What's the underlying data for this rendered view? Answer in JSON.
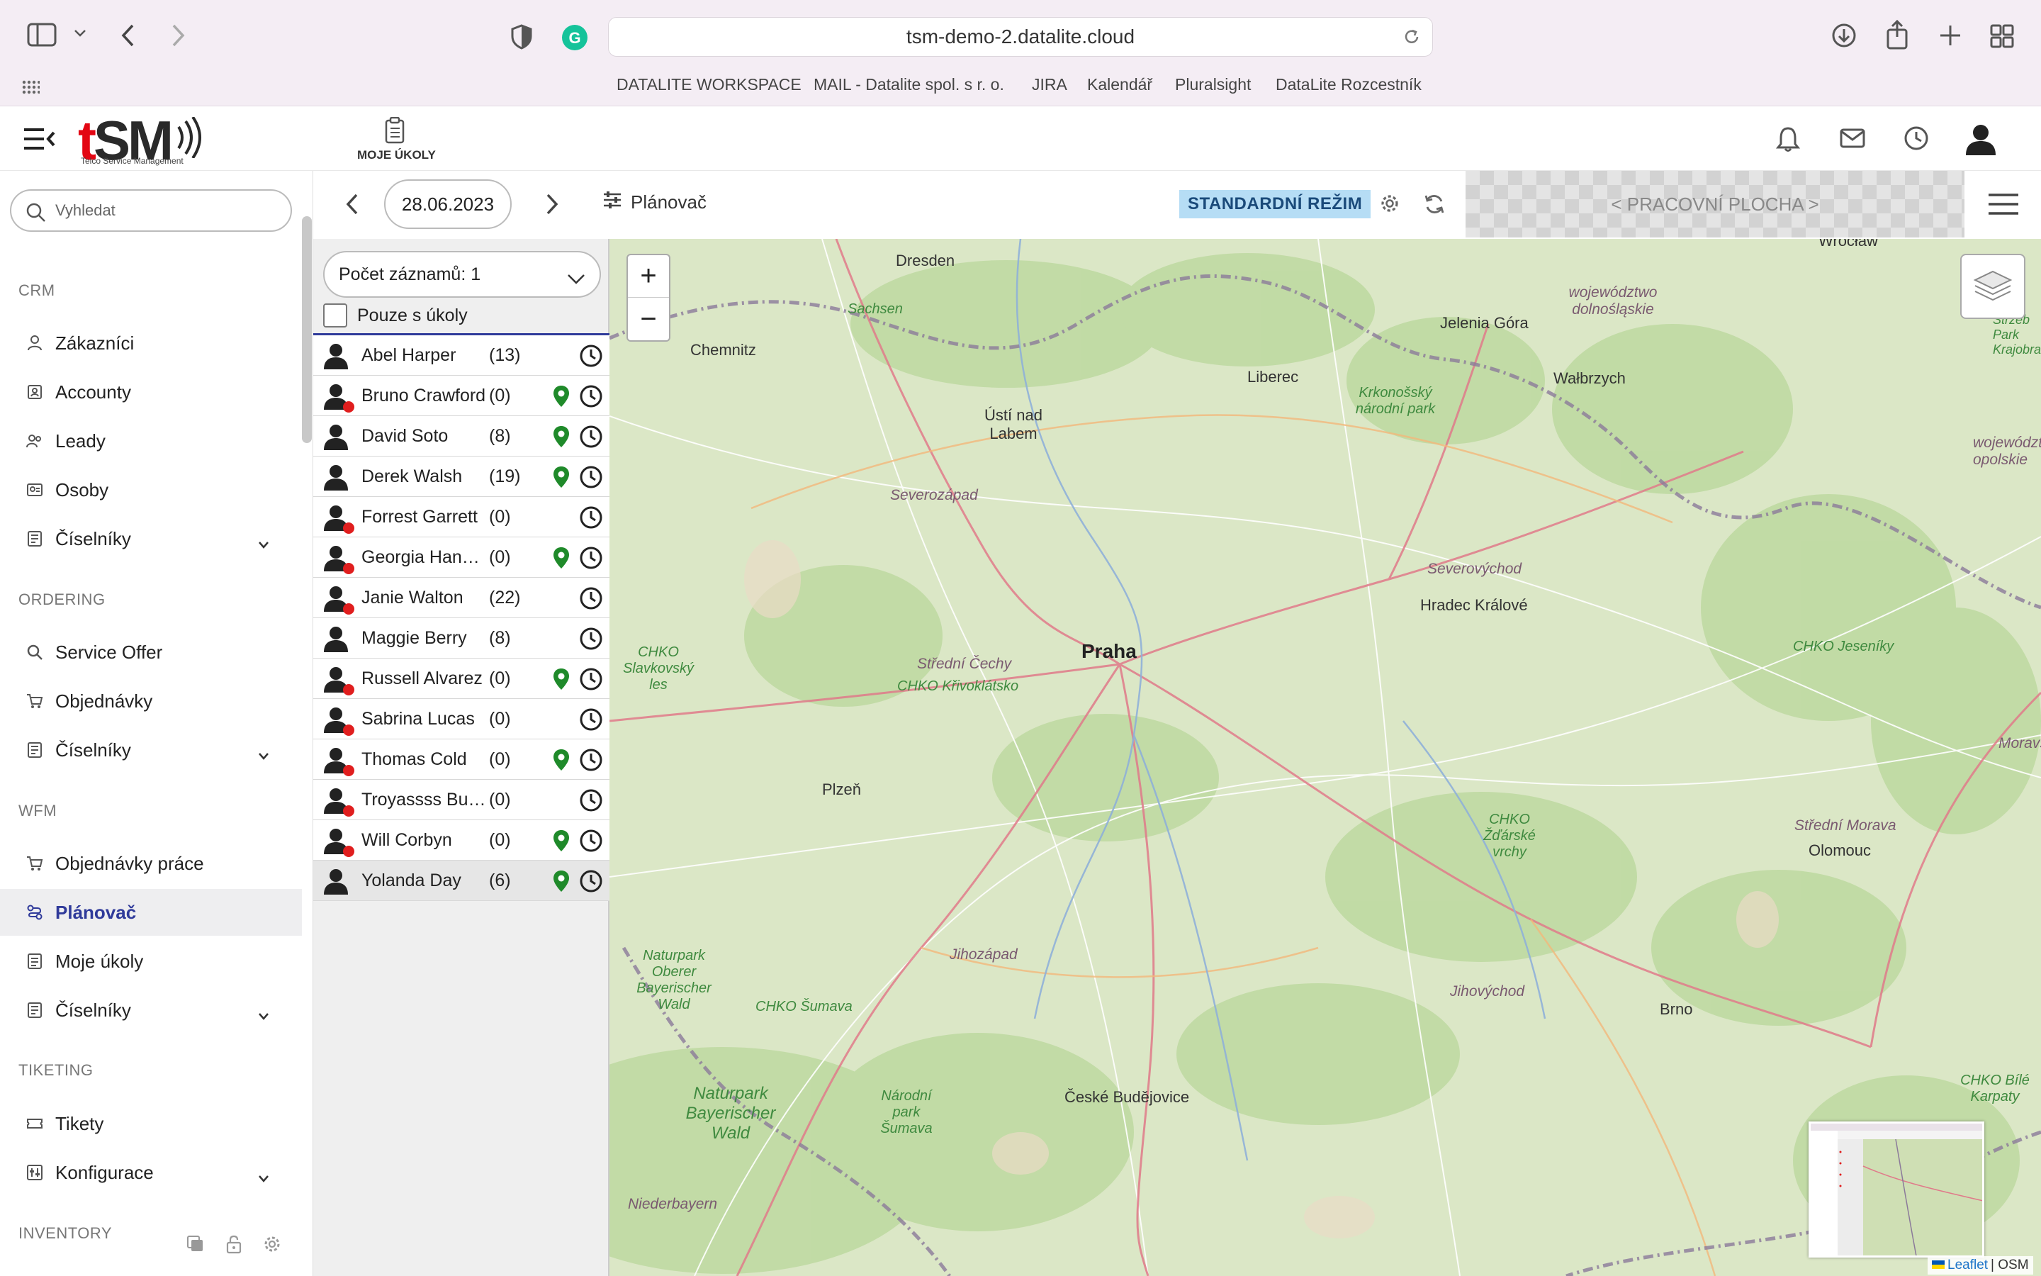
{
  "browser": {
    "url": "tsm-demo-2.datalite.cloud",
    "bookmarks": [
      "DATALITE WORKSPACE",
      "MAIL - Datalite spol. s r. o.",
      "JIRA",
      "Kalendář",
      "Pluralsight",
      "DataLite Rozcestník"
    ]
  },
  "header": {
    "logo_text": "tSM",
    "logo_subtitle": "Telco Service Management",
    "tasks_label": "MOJE ÚKOLY"
  },
  "sidebar": {
    "search_placeholder": "Vyhledat",
    "sections": {
      "crm": "CRM",
      "ordering": "ORDERING",
      "wfm": "WFM",
      "ticketing": "TIKETING",
      "inventory": "INVENTORY"
    },
    "items": {
      "zakaznici": "Zákazníci",
      "accounty": "Accounty",
      "leady": "Leady",
      "osoby": "Osoby",
      "ciselniky1": "Číselníky",
      "service_offer": "Service Offer",
      "objednavky": "Objednávky",
      "ciselniky2": "Číselníky",
      "objednavky_prace": "Objednávky práce",
      "planovac": "Plánovač",
      "moje_ukoly": "Moje úkoly",
      "ciselniky3": "Číselníky",
      "tikety": "Tikety",
      "konfigurace": "Konfigurace"
    },
    "active_item": "Plánovač"
  },
  "toolbar": {
    "date": "28.06.2023",
    "planner_label": "Plánovač",
    "mode_badge": "STANDARDNÍ REŽIM",
    "workspace_label": "< PRACOVNÍ PLOCHA >"
  },
  "workers": {
    "count_label": "Počet záznamů: 1",
    "only_tasks_label": "Pouze s úkoly",
    "list": [
      {
        "name": "Abel Harper",
        "count": "(13)",
        "offline": false,
        "located": false
      },
      {
        "name": "Bruno Crawford",
        "count": "(0)",
        "offline": true,
        "located": true
      },
      {
        "name": "David Soto",
        "count": "(8)",
        "offline": false,
        "located": true
      },
      {
        "name": "Derek Walsh",
        "count": "(19)",
        "offline": false,
        "located": true
      },
      {
        "name": "Forrest Garrett",
        "count": "(0)",
        "offline": true,
        "located": false
      },
      {
        "name": "Georgia Hansen",
        "count": "(0)",
        "offline": true,
        "located": true
      },
      {
        "name": "Janie Walton",
        "count": "(22)",
        "offline": true,
        "located": false
      },
      {
        "name": "Maggie Berry",
        "count": "(8)",
        "offline": false,
        "located": false
      },
      {
        "name": "Russell Alvarez",
        "count": "(0)",
        "offline": true,
        "located": true
      },
      {
        "name": "Sabrina Lucas",
        "count": "(0)",
        "offline": true,
        "located": false
      },
      {
        "name": "Thomas Cold",
        "count": "(0)",
        "offline": true,
        "located": true
      },
      {
        "name": "Troyassss Butler",
        "count": "(0)",
        "offline": true,
        "located": false
      },
      {
        "name": "Will Corbyn",
        "count": "(0)",
        "offline": true,
        "located": true
      },
      {
        "name": "Yolanda Day",
        "count": "(6)",
        "offline": false,
        "located": true
      }
    ],
    "selected": "Yolanda Day"
  },
  "map": {
    "zoom_in": "+",
    "zoom_out": "−",
    "attribution_leaflet": "Leaflet",
    "attribution_osm": "| OSM",
    "labels": {
      "dresden": "Dresden",
      "wroclaw": "Wrocław",
      "sachsen": "Sachsen",
      "chemnitz": "Chemnitz",
      "liberec": "Liberec",
      "jelenia_gora": "Jelenia Góra",
      "walbrzych": "Wałbrzych",
      "dolnoslaskie": "województwo dolnośląskie",
      "opolskie": "województwo opolskie",
      "krkonossky": "Krkonošský národní park",
      "usti": "Ústí nad Labem",
      "severozapad": "Severozápad",
      "severovychod": "Severovýchod",
      "hradec": "Hradec Králové",
      "praha": "Praha",
      "stredni_cechy": "Střední Čechy",
      "krivoklatsko": "CHKO Křivoklátsko",
      "slavkovsky": "CHKO Slavkovský les",
      "jeseniky": "CHKO Jeseníky",
      "plzen": "Plzeň",
      "zdarske": "CHKO Žďárské vrchy",
      "stredni_morava": "Střední Morava",
      "olomouc": "Olomouc",
      "jihozapad": "Jihozápad",
      "jihovychod": "Jihovýchod",
      "brno": "Brno",
      "oberer_wald": "Naturpark Oberer Bayerischer Wald",
      "sumava_chko": "CHKO Šumava",
      "sumava_np": "Národní park Šumava",
      "bayerischer_wald": "Naturpark Bayerischer Wald",
      "ceske_budejovice": "České Budějovice",
      "niederbayern": "Niederbayern",
      "bile_karpaty": "CHKO Bílé Karpaty",
      "moravsko": "Moravs",
      "krajobraz": "Strzeb Park Krajobraz"
    }
  },
  "colors": {
    "accent": "#2f3a9a",
    "badge_bg": "#b6ddf5",
    "offline_dot": "#e01e1e",
    "pin": "#1f8a2a",
    "logo_red": "#e30613"
  }
}
